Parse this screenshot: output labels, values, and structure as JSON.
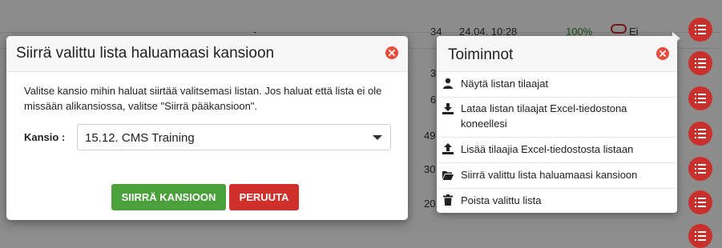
{
  "background": {
    "row1": {
      "dash": "-",
      "count": "34",
      "date": "24.04. 10:28",
      "percent": "100%",
      "status": "Ei"
    },
    "partial_counts": [
      "3",
      "6",
      "49",
      "30",
      "20"
    ]
  },
  "modal": {
    "title": "Siirrä valittu lista haluamaasi kansioon",
    "description": "Valitse kansio mihin haluat siirtää valitsemasi listan. Jos haluat että lista ei ole missään alikansiossa, valitse \"Siirrä pääkansioon\".",
    "folder_label": "Kansio :",
    "folder_selected": "15.12. CMS Training",
    "move_button": "SIIRRÄ KANSIOON",
    "cancel_button": "PERUUTA"
  },
  "actions": {
    "title": "Toiminnot",
    "items": [
      {
        "label": "Näytä listan tilaajat",
        "icon": "user-icon"
      },
      {
        "label": "Lataa listan tilaajat Excel-tiedostona koneellesi",
        "icon": "download-icon"
      },
      {
        "label": "Lisää tilaajia Excel-tiedostosta listaan",
        "icon": "upload-icon"
      },
      {
        "label": "Siirrä valittu lista haluamaasi kansioon",
        "icon": "folder-open-icon"
      },
      {
        "label": "Poista valittu lista",
        "icon": "trash-icon"
      }
    ]
  },
  "colors": {
    "primary_action": "#4aa03a",
    "danger": "#d0302a",
    "close_icon": "#e74c3c"
  }
}
